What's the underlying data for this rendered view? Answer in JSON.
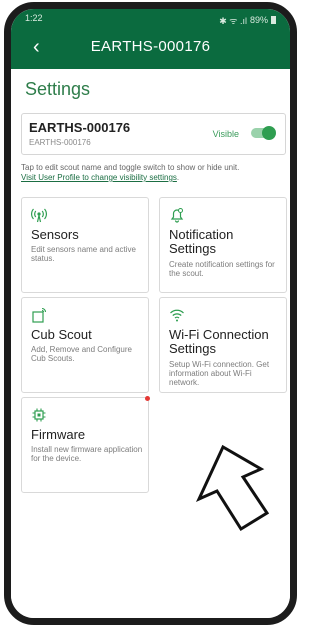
{
  "status_bar": {
    "time": "1:22",
    "icons": "✱ ᯤ .ıl",
    "battery": "89%"
  },
  "header": {
    "back_icon": "‹",
    "title": "EARTHS-000176"
  },
  "settings_heading": "Settings",
  "unit": {
    "name": "EARTHS-000176",
    "sub": "EARTHS-000176",
    "visibility_label": "Visible",
    "visible": true
  },
  "hint": {
    "text": "Tap to edit scout name and toggle switch to show or hide unit.",
    "link": "Visit User Profile to change visibility settings"
  },
  "tiles": [
    {
      "icon": "antenna-icon",
      "title": "Sensors",
      "description": "Edit sensors name and active status."
    },
    {
      "icon": "bell-icon",
      "title": "Notification Settings",
      "description": "Create notification settings for the scout."
    },
    {
      "icon": "cub-scout-icon",
      "title": "Cub Scout",
      "description": "Add, Remove and Configure Cub Scouts."
    },
    {
      "icon": "wifi-icon",
      "title": "Wi-Fi Connection Settings",
      "description": "Setup Wi-Fi connection. Get information about Wi-Fi network."
    },
    {
      "icon": "chip-icon",
      "title": "Firmware",
      "description": "Install new firmware application for the device.",
      "has_update_badge": true
    }
  ],
  "colors": {
    "header": "#0b6b3f",
    "accent": "#2f9e51",
    "badge": "#e53935"
  }
}
